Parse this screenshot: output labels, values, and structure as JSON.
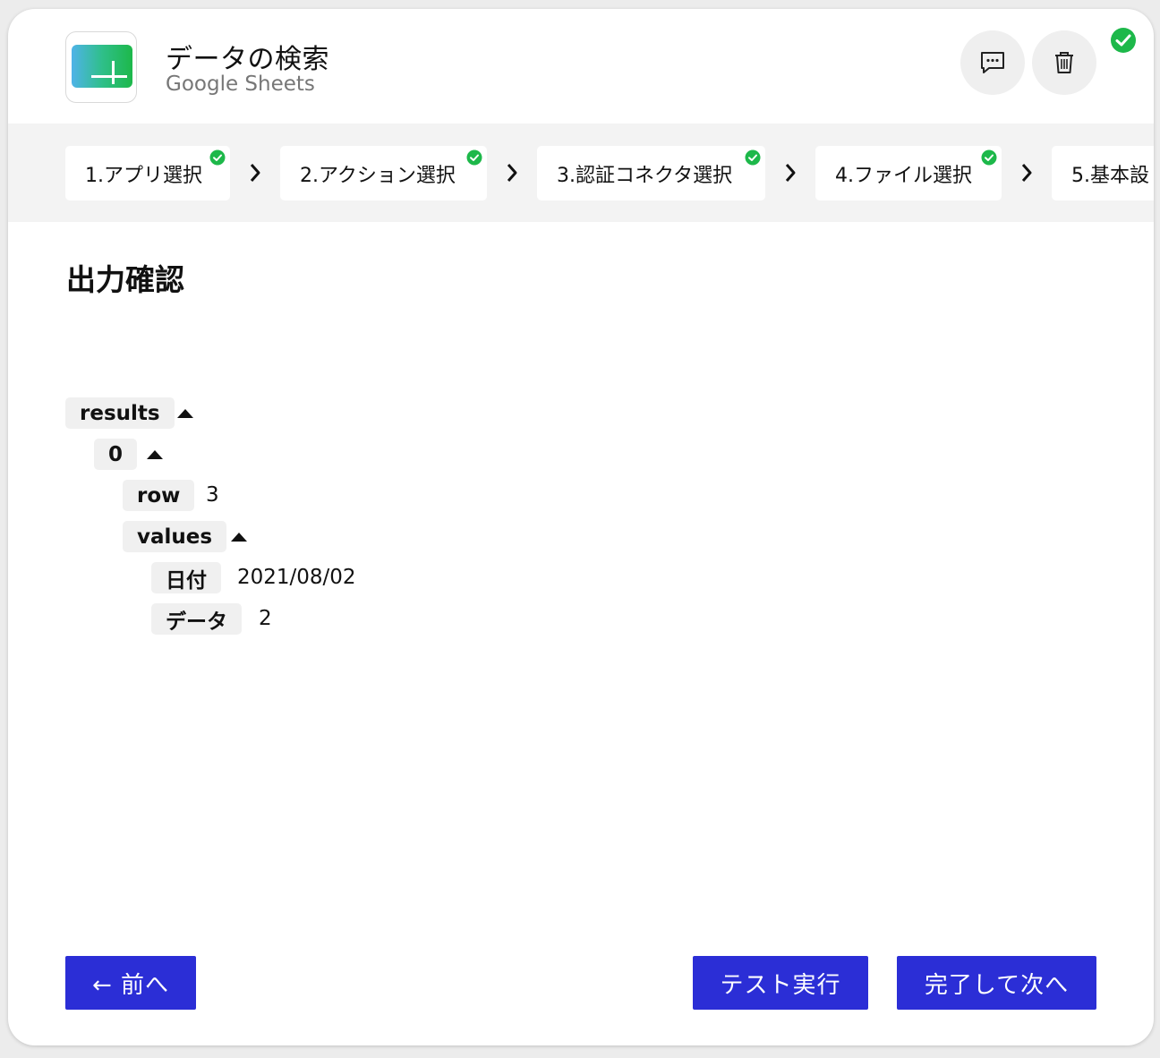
{
  "header": {
    "title": "データの検索",
    "subtitle": "Google Sheets",
    "app_icon": "google-sheets-icon",
    "comment_icon": "comment-icon",
    "delete_icon": "trash-icon",
    "status_icon": "check-circle-icon"
  },
  "steps": [
    {
      "label": "1.アプリ選択",
      "done": true
    },
    {
      "label": "2.アクション選択",
      "done": true
    },
    {
      "label": "3.認証コネクタ選択",
      "done": true
    },
    {
      "label": "4.ファイル選択",
      "done": true
    },
    {
      "label": "5.基本設",
      "done": false
    }
  ],
  "output": {
    "title": "出力確認",
    "tree": {
      "results_key": "results",
      "index_key": "0",
      "row_key": "row",
      "row_value": "3",
      "values_key": "values",
      "date_key": "日付",
      "date_value": "2021/08/02",
      "data_key": "データ",
      "data_value": "2"
    }
  },
  "footer": {
    "back_label": "← 前へ",
    "test_label": "テスト実行",
    "next_label": "完了して次へ"
  },
  "colors": {
    "accent": "#2b2ed6",
    "success": "#1db84a",
    "key_bg": "#f0f0f0"
  }
}
